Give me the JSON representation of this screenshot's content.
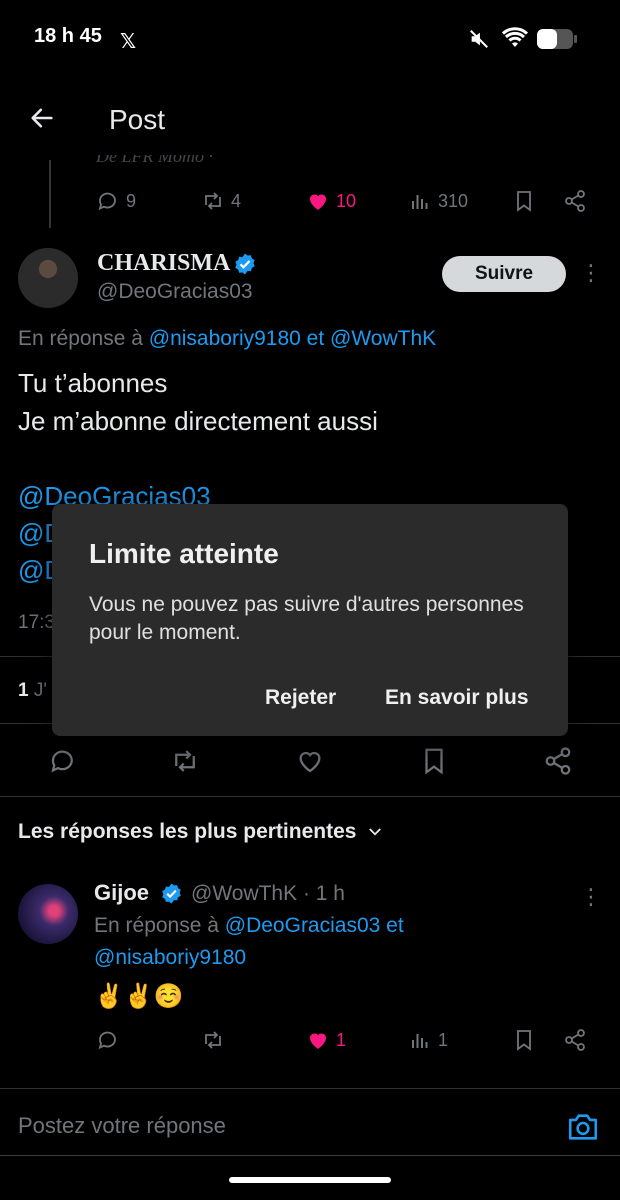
{
  "status_bar": {
    "time": "18 h 45",
    "app_logo": "𝕏"
  },
  "header": {
    "title": "Post",
    "back_icon": "arrow-left-icon"
  },
  "previous_tweet": {
    "text_fragment": "De LFR Momo · ",
    "reply_count": "9",
    "retweet_count": "4",
    "like_count": "10",
    "view_count": "310",
    "liked": true
  },
  "main_tweet": {
    "display_name": "CHARISMA",
    "handle": "@DeoGracias03",
    "follow_label": "Suivre",
    "reply_to_prefix": "En réponse à ",
    "reply_to_user1": "@nisaboriy9180",
    "reply_to_sep": " et ",
    "reply_to_user2": "@WowThK",
    "line1": "Tu t’abonnes",
    "line2": "Je m’abonne directement aussi",
    "mentions": [
      "@DeoGracias03",
      "@D",
      "@D"
    ],
    "time_fragment": "17:3",
    "stats_count": "1",
    "stats_label": " J'"
  },
  "dialog": {
    "title": "Limite atteinte",
    "message": "Vous ne pouvez pas suivre d'autres personnes pour le moment.",
    "dismiss_label": "Rejeter",
    "learn_more_label": "En savoir plus"
  },
  "replies_header": {
    "label": "Les réponses les plus pertinentes"
  },
  "reply": {
    "display_name": "Gijoe",
    "handle": "@WowThK · 1 h",
    "reply_to_prefix": "En réponse à ",
    "reply_to_user1": "@DeoGracias03",
    "reply_to_sep": " et",
    "reply_to_user2": "@nisaboriy9180",
    "body": "✌️✌️☺️",
    "like_count": "1",
    "view_count": "1",
    "liked": true
  },
  "compose": {
    "placeholder": "Postez votre réponse"
  },
  "colors": {
    "accent": "#1d9bf0",
    "like": "#f91880",
    "background": "#000000",
    "dialog": "#2b2b2b"
  }
}
